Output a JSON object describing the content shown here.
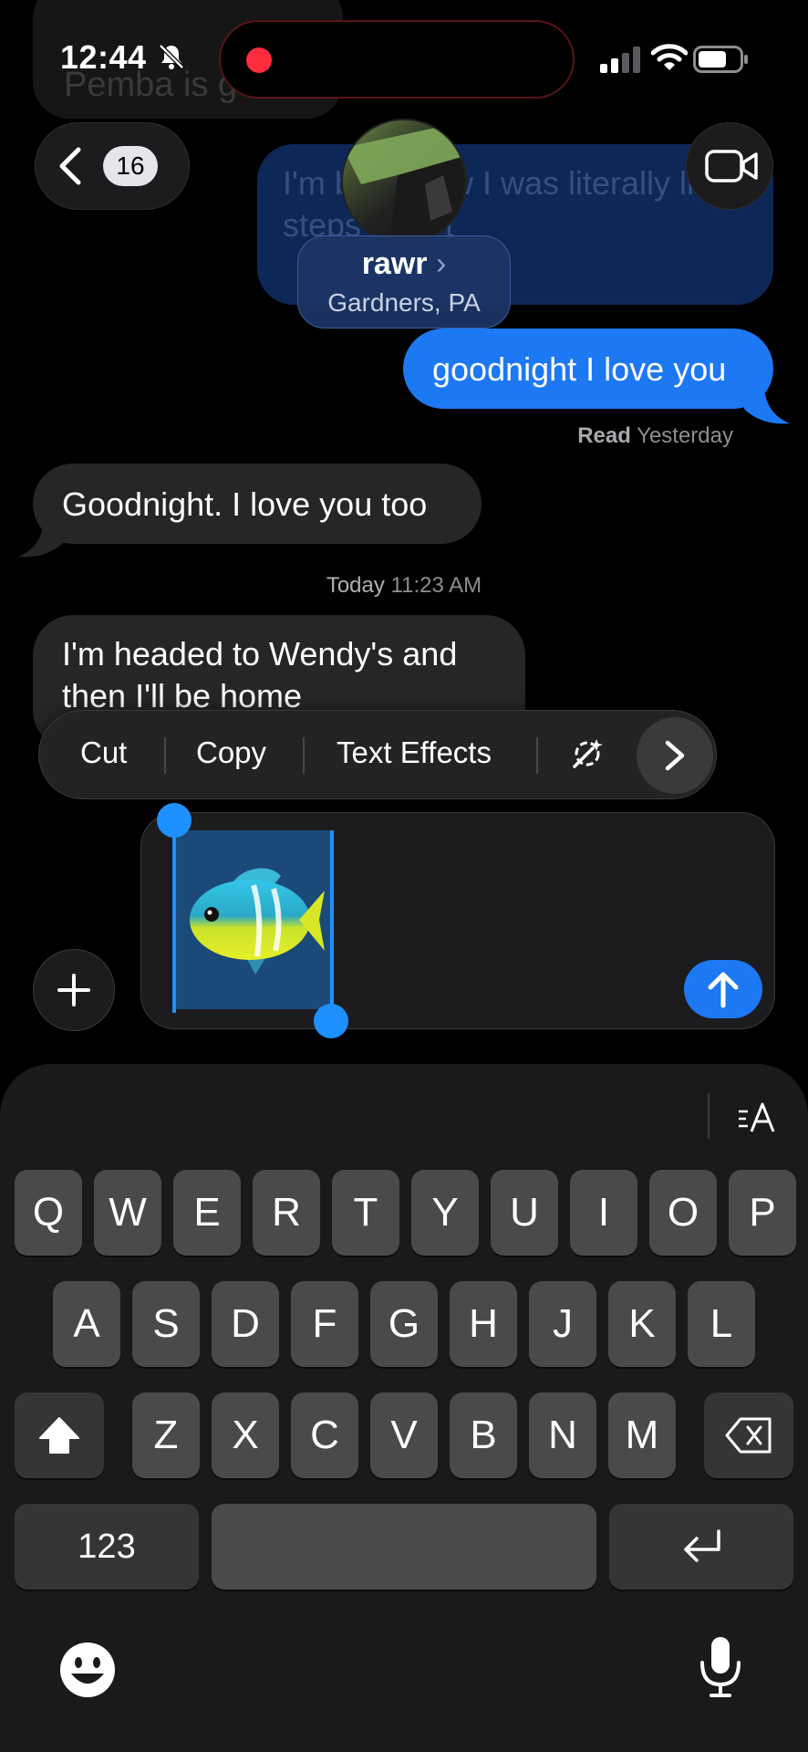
{
  "status_bar": {
    "time": "12:44",
    "icons": [
      "bell-slash-icon",
      "recording-dot-icon",
      "cellular-signal-icon",
      "wifi-icon",
      "battery-icon"
    ]
  },
  "scrolled_previous": {
    "text": "Pemba is g"
  },
  "nav": {
    "back_count": "16",
    "contact_name": "rawr",
    "contact_chevron": "›",
    "contact_location": "Gardners, PA"
  },
  "messages": {
    "faded_sent": "I'm back now I was literally like 5 steps from t",
    "sent_1": "goodnight I love you",
    "read_label": "Read",
    "read_time": "Yesterday",
    "received_1": "Goodnight. I love you too",
    "day_label": "Today",
    "day_time": "11:23 AM",
    "received_2": "I'm headed to Wendy's and then I'll be home"
  },
  "context_menu": {
    "items": [
      "Cut",
      "Copy",
      "Text Effects"
    ],
    "writing_tools_icon": "sparkle-wand-icon",
    "more_icon": "chevron-right-icon"
  },
  "compose": {
    "content_emoji": "tropical-fish",
    "plus_icon": "plus-icon",
    "send_icon": "arrow-up-icon"
  },
  "keyboard": {
    "row1": [
      "Q",
      "W",
      "E",
      "R",
      "T",
      "Y",
      "U",
      "I",
      "O",
      "P"
    ],
    "row2": [
      "A",
      "S",
      "D",
      "F",
      "G",
      "H",
      "J",
      "K",
      "L"
    ],
    "row3": [
      "Z",
      "X",
      "C",
      "V",
      "B",
      "N",
      "M"
    ],
    "numbers_label": "123",
    "format_icon": "text-format-icon",
    "emoji_icon": "emoji-icon",
    "mic_icon": "microphone-icon"
  },
  "colors": {
    "imessage_blue": "#1d78f4",
    "received_gray": "#262628",
    "selection_blue": "#1e90ff",
    "recording_red": "#ff2d3d"
  }
}
